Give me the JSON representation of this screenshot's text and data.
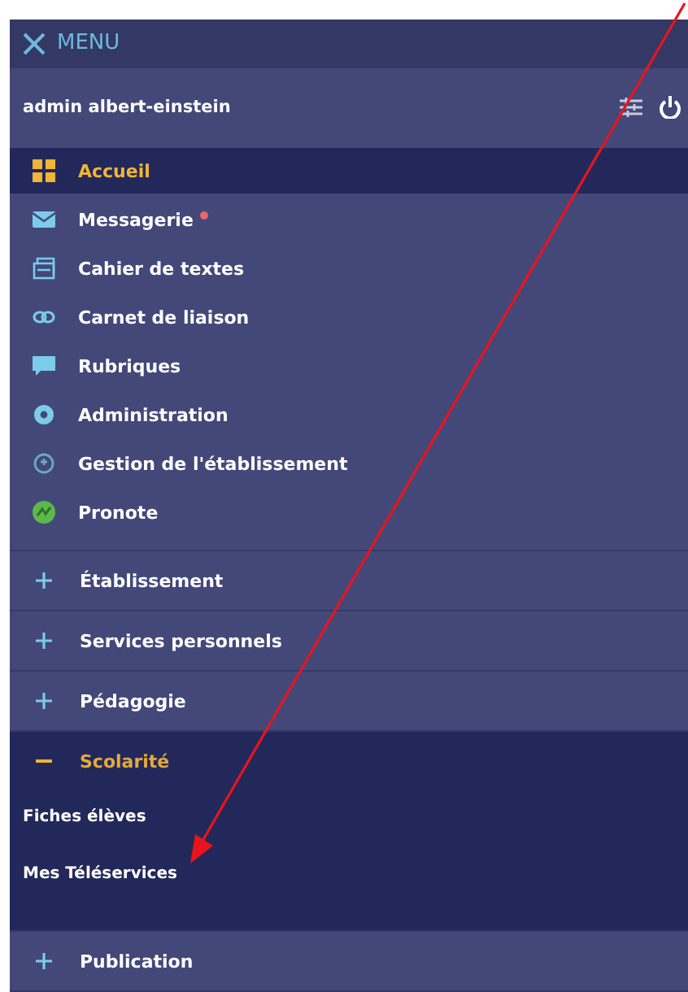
{
  "header": {
    "title": "MENU"
  },
  "user": {
    "name": "admin albert-einstein"
  },
  "nav_items": [
    {
      "label": "Accueil",
      "selected": true,
      "notification": false
    },
    {
      "label": "Messagerie",
      "selected": false,
      "notification": true
    },
    {
      "label": "Cahier de textes",
      "selected": false,
      "notification": false
    },
    {
      "label": "Carnet de liaison",
      "selected": false,
      "notification": false
    },
    {
      "label": "Rubriques",
      "selected": false,
      "notification": false
    },
    {
      "label": "Administration",
      "selected": false,
      "notification": false
    },
    {
      "label": "Gestion de l'établissement",
      "selected": false,
      "notification": false
    },
    {
      "label": "Pronote",
      "selected": false,
      "notification": false
    }
  ],
  "sections": [
    {
      "label": "Établissement",
      "expanded": false
    },
    {
      "label": "Services personnels",
      "expanded": false
    },
    {
      "label": "Pédagogie",
      "expanded": false
    },
    {
      "label": "Scolarité",
      "expanded": true,
      "children": [
        "Fiches élèves",
        "Mes Téléservices"
      ]
    },
    {
      "label": "Publication",
      "expanded": false
    }
  ]
}
